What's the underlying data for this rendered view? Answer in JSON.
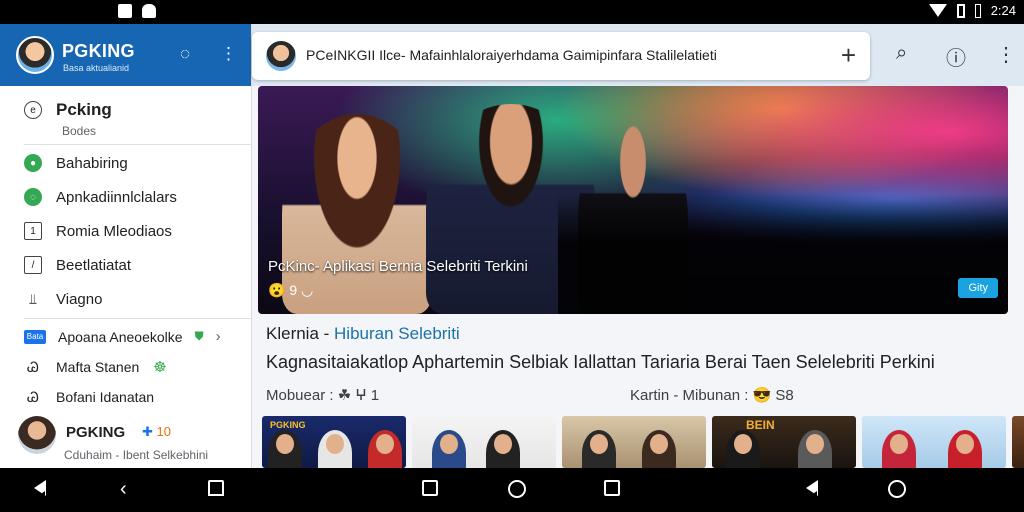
{
  "status_bar": {
    "time": "2:24",
    "left_icons": [
      "notification-icon",
      "android-icon"
    ]
  },
  "sidebar": {
    "app_name": "PGKING",
    "app_subtitle": "Basa aktualianid",
    "section_title": "Pcking",
    "section_subtitle": "Bodes",
    "items": [
      {
        "label": "Bahabiring",
        "icon": "green-dot-icon"
      },
      {
        "label": "Apnkadiinnlclalars",
        "icon": "green-chat-icon"
      },
      {
        "label": "Romia Mleodiaos",
        "icon": "doc-icon"
      },
      {
        "label": "Beetlatiatat",
        "icon": "square-slash-icon"
      },
      {
        "label": "Viagno",
        "icon": "bars-icon"
      }
    ],
    "promo": {
      "badge": "Bata",
      "label": "Apoana Aneoekolke"
    },
    "extra_items": [
      {
        "label": "Mafta Stanen",
        "suffix": "☸"
      },
      {
        "label": "Bofani Idanatan"
      }
    ],
    "footer": {
      "name": "PGKING",
      "badge": "10",
      "subtitle": "Cduhaim - Ibent Selkebhini"
    }
  },
  "topbar": {
    "search_text": "PCeINKGII Ilce- Mafainhlaloraiyerhdama Gaimipinfara Stalilelatieti"
  },
  "hero": {
    "title": "PcKinc- Aplikasi Bernia Selebriti Terkini",
    "reactions": "😮 9 ◡",
    "tag": "Gity"
  },
  "article": {
    "category": "Klernia",
    "category_accent": "Hiburan Selebriti",
    "headline": "Kagnasitaiakatlop Aphartemin Selbiak Iallattan Tariaria Berai Taen Selelebriti Perkini",
    "meta_left": "Mobuear : ☘ ⵖ 1",
    "meta_right": "Kartin - Mibunan : 😎 S8"
  },
  "thumbnails": [
    {
      "caption": "PGKING"
    },
    {
      "caption": ""
    },
    {
      "caption": ""
    },
    {
      "caption": "BEIN"
    },
    {
      "caption": ""
    }
  ],
  "colors": {
    "header_blue": "#1766b3",
    "accent_link": "#1a73a8",
    "tag_blue": "#1aa3e0"
  }
}
